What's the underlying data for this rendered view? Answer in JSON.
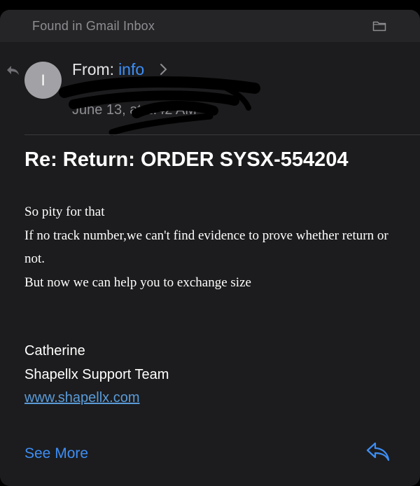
{
  "topbar": {
    "title": "Found in Gmail Inbox",
    "folder_icon": "folder-icon"
  },
  "header": {
    "avatar_initial": "I",
    "from_label": "From:",
    "from_name": "info",
    "date_text": "June 13,   at 2:42 AM"
  },
  "message": {
    "subject": "Re: Return: ORDER SYSX-554204",
    "body_lines": [
      "So pity for that",
      "If no track number,we can't find evidence to prove whether return or not.",
      "But now we can help you to exchange size"
    ],
    "signature": {
      "name": "Catherine",
      "team": "Shapellx Support Team",
      "link": "www.shapellx.com"
    }
  },
  "footer": {
    "see_more": "See More",
    "reply_icon": "reply-arrow-icon"
  },
  "colors": {
    "accent": "#3d8ef5",
    "background": "#1c1c1e",
    "secondary_text": "#8e8e93"
  }
}
